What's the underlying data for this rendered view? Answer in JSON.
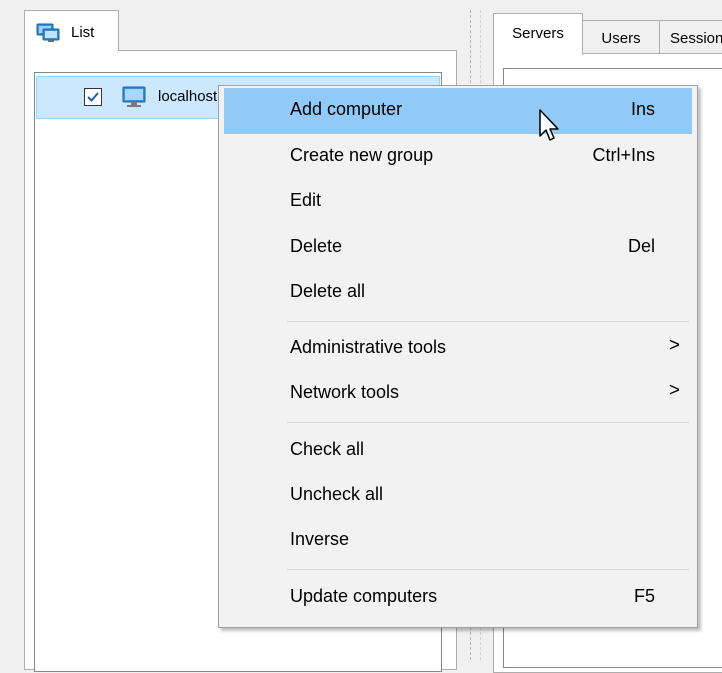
{
  "left_panel": {
    "tab_label": "List",
    "tree": [
      {
        "label": "localhost",
        "checked": true,
        "icon": "monitor-icon"
      }
    ]
  },
  "right_panel": {
    "tabs": [
      {
        "label": "Servers",
        "active": true
      },
      {
        "label": "Users",
        "active": false
      },
      {
        "label": "Sessions",
        "active": false
      }
    ]
  },
  "context_menu": {
    "groups": [
      [
        {
          "label": "Add computer",
          "shortcut": "Ins",
          "highlighted": true
        },
        {
          "label": "Create new group",
          "shortcut": "Ctrl+Ins"
        },
        {
          "label": "Edit",
          "shortcut": ""
        },
        {
          "label": "Delete",
          "shortcut": "Del"
        },
        {
          "label": "Delete all",
          "shortcut": ""
        }
      ],
      [
        {
          "label": "Administrative tools",
          "submenu": true
        },
        {
          "label": "Network tools",
          "submenu": true
        }
      ],
      [
        {
          "label": "Check all",
          "shortcut": ""
        },
        {
          "label": "Uncheck all",
          "shortcut": ""
        },
        {
          "label": "Inverse",
          "shortcut": ""
        }
      ],
      [
        {
          "label": "Update computers",
          "shortcut": "F5"
        }
      ]
    ],
    "submenu_arrow": ">"
  },
  "colors": {
    "highlight": "#91c9f7",
    "selection": "#cce8ff",
    "menu_bg": "#f2f2f2"
  }
}
